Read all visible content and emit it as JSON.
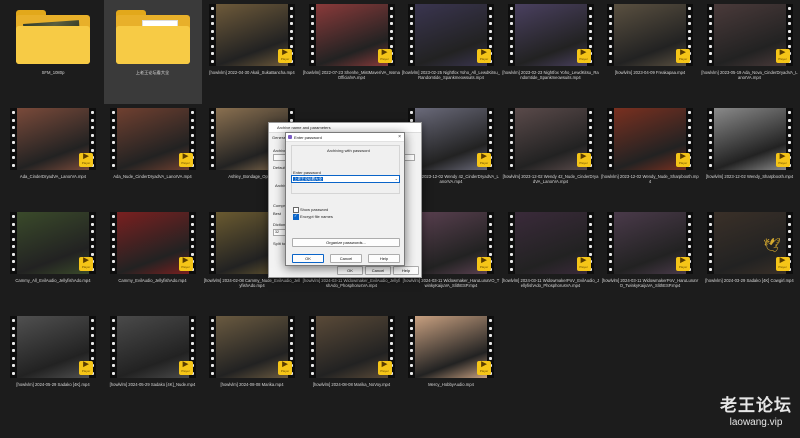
{
  "files": [
    {
      "name": "SFM_1080p",
      "kind": "folder"
    },
    {
      "name": "上老王论坛看大全",
      "kind": "folder-doc",
      "selected": true
    },
    {
      "name": "[howlvlm] 2022-04-30 Akali_SukaBancha.mp4",
      "kind": "video",
      "color": "#6e5a3a"
    },
    {
      "name": "[howlvlm] 2022-07-23 Shenhe_MistMaveriVA_IssmaOfficialVA.mp4",
      "kind": "video",
      "color": "#8a3a3a"
    },
    {
      "name": "[howlvlm] 2023-02-25 Nightfox Yoho_All_LewdKitsu_Randomtide_Spankmeowsuits.mp4",
      "kind": "video",
      "color": "#3a3550"
    },
    {
      "name": "[howlvlm] 2023-02-23 Nightfox Yoho_LewdKitsu_Randomtide_Spankmeowsuits.mp4",
      "kind": "video",
      "color": "#4a4060"
    },
    {
      "name": "[howlvlm] 2023-04-09 Freakapaa.mp4",
      "kind": "video",
      "color": "#5a5040"
    },
    {
      "name": "[howlvlm] 2023-05-19 Ada_Nova_CinderDryadVA_LanorVA.mp4",
      "kind": "video",
      "color": "#4a3a3a"
    },
    {
      "name": "Ada_CinderDryadVA_LanorVA.mp4",
      "kind": "video",
      "color": "#7a4a3a"
    },
    {
      "name": "Ada_Nude_CinderDryadVA_LanorVA.mp4",
      "kind": "video",
      "color": "#704030"
    },
    {
      "name": "Ashley_Bondage_Opus...",
      "kind": "video",
      "color": "#8a7050",
      "hidden_partly": true
    },
    {
      "name": "",
      "kind": "blank"
    },
    {
      "name": "[howlvlm] 2023-12-02 Wendy 42_CinderDryadVA_LanorVA.mp4",
      "kind": "video",
      "color": "#6a6a7a"
    },
    {
      "name": "[howlvlm] 2023-12-02 Wendy 42_Nude_CinderDryadVA_LanorVA.mp4",
      "kind": "video",
      "color": "#5a4a4a"
    },
    {
      "name": "[howlvlm] 2023-12-02 Wendy_Nude_Sharpbooth.mp4",
      "kind": "video",
      "color": "#7a3020"
    },
    {
      "name": "[howlvlm] 2023-12-02 Wendy_Sharpbooth.mp4",
      "kind": "video",
      "color": "#8a8a8a"
    },
    {
      "name": "Cammy_All_EvilAudio_JellyfishAdo.mp4",
      "kind": "video",
      "color": "#3a4a2a"
    },
    {
      "name": "Cammy_EvilAudio_JellyfishAdo.mp4",
      "kind": "video",
      "color": "#7a2020"
    },
    {
      "name": "[howlvlm] 2024-02-08 Cammy_Nude_EvilAudio_JellyfishAdo.mp4",
      "kind": "video",
      "color": "#6a5a30"
    },
    {
      "name": "[howlvlm] 2024-03-11 Widowmaker_EvilAudio_JellyfishAdo_PhosphorusVA.mp4",
      "kind": "video",
      "color": "#4a3040"
    },
    {
      "name": "[howlvlm] 2024-03-11 Widowmaker_HaruLunaVO_TwinkyKaijuVA_SlithESP.mp4",
      "kind": "video",
      "color": "#5a4050"
    },
    {
      "name": "[howlvlm] 2024-03-11 WidowmakerPoV_EvilAudio_JellyfishAdo_PhosphorusVA.mp4",
      "kind": "video",
      "color": "#3a2a3a"
    },
    {
      "name": "[howlvlm] 2024-03-11 WidowmakerPoV_HaruLunaVO_TwinkyKaijuVA_SlithESP.mp4",
      "kind": "video",
      "color": "#4a3a4a"
    },
    {
      "name": "[howlvlm] 2024-03-29 Sadako [4K] Cowgirl.mp4",
      "kind": "video",
      "color": "#3a3028"
    },
    {
      "name": "[howlvlm] 2024-05-29 Sadako [4K].mp4",
      "kind": "video",
      "color": "#505050"
    },
    {
      "name": "[howlvlm] 2024-05-29 Sadako [4K]_Nude.mp4",
      "kind": "video",
      "color": "#4a4a4a"
    },
    {
      "name": "[howlvlm] 2024-08-08 Marika.mp4",
      "kind": "video",
      "color": "#6a5a40"
    },
    {
      "name": "[howlvlm] 2024-08-08 Marika_NoVoy.mp4",
      "kind": "video",
      "color": "#5a4a38"
    },
    {
      "name": "Mercy_HobbyAudio.mp4",
      "kind": "video",
      "color": "#c8a080"
    }
  ],
  "player_badge": "Player",
  "archive_dialog": {
    "title": "Archive name and parameters",
    "tab_general": "General",
    "label_archive": "Archive",
    "archive_value": "上老王...",
    "label_default": "Default",
    "label_archive_format": "Archiv",
    "label_compression": "Compre",
    "label_best": "Best",
    "label_dictionary": "Dictiona",
    "dict_value": "32",
    "label_split": "Split to",
    "ok": "OK",
    "cancel": "Cancel",
    "help": "Help"
  },
  "password_dialog": {
    "title": "Enter password",
    "group_title": "Archiving with password",
    "label_enter": "Enter password",
    "password_value": "上老王论坛看大全",
    "show_password": "Show password",
    "encrypt_names": "Encrypt file names",
    "organize": "Organize passwords...",
    "ok": "OK",
    "cancel": "Cancel",
    "help": "Help",
    "show_password_checked": false,
    "encrypt_names_checked": true
  },
  "watermark": {
    "cn": "老王论坛",
    "url": "laowang.vip"
  }
}
